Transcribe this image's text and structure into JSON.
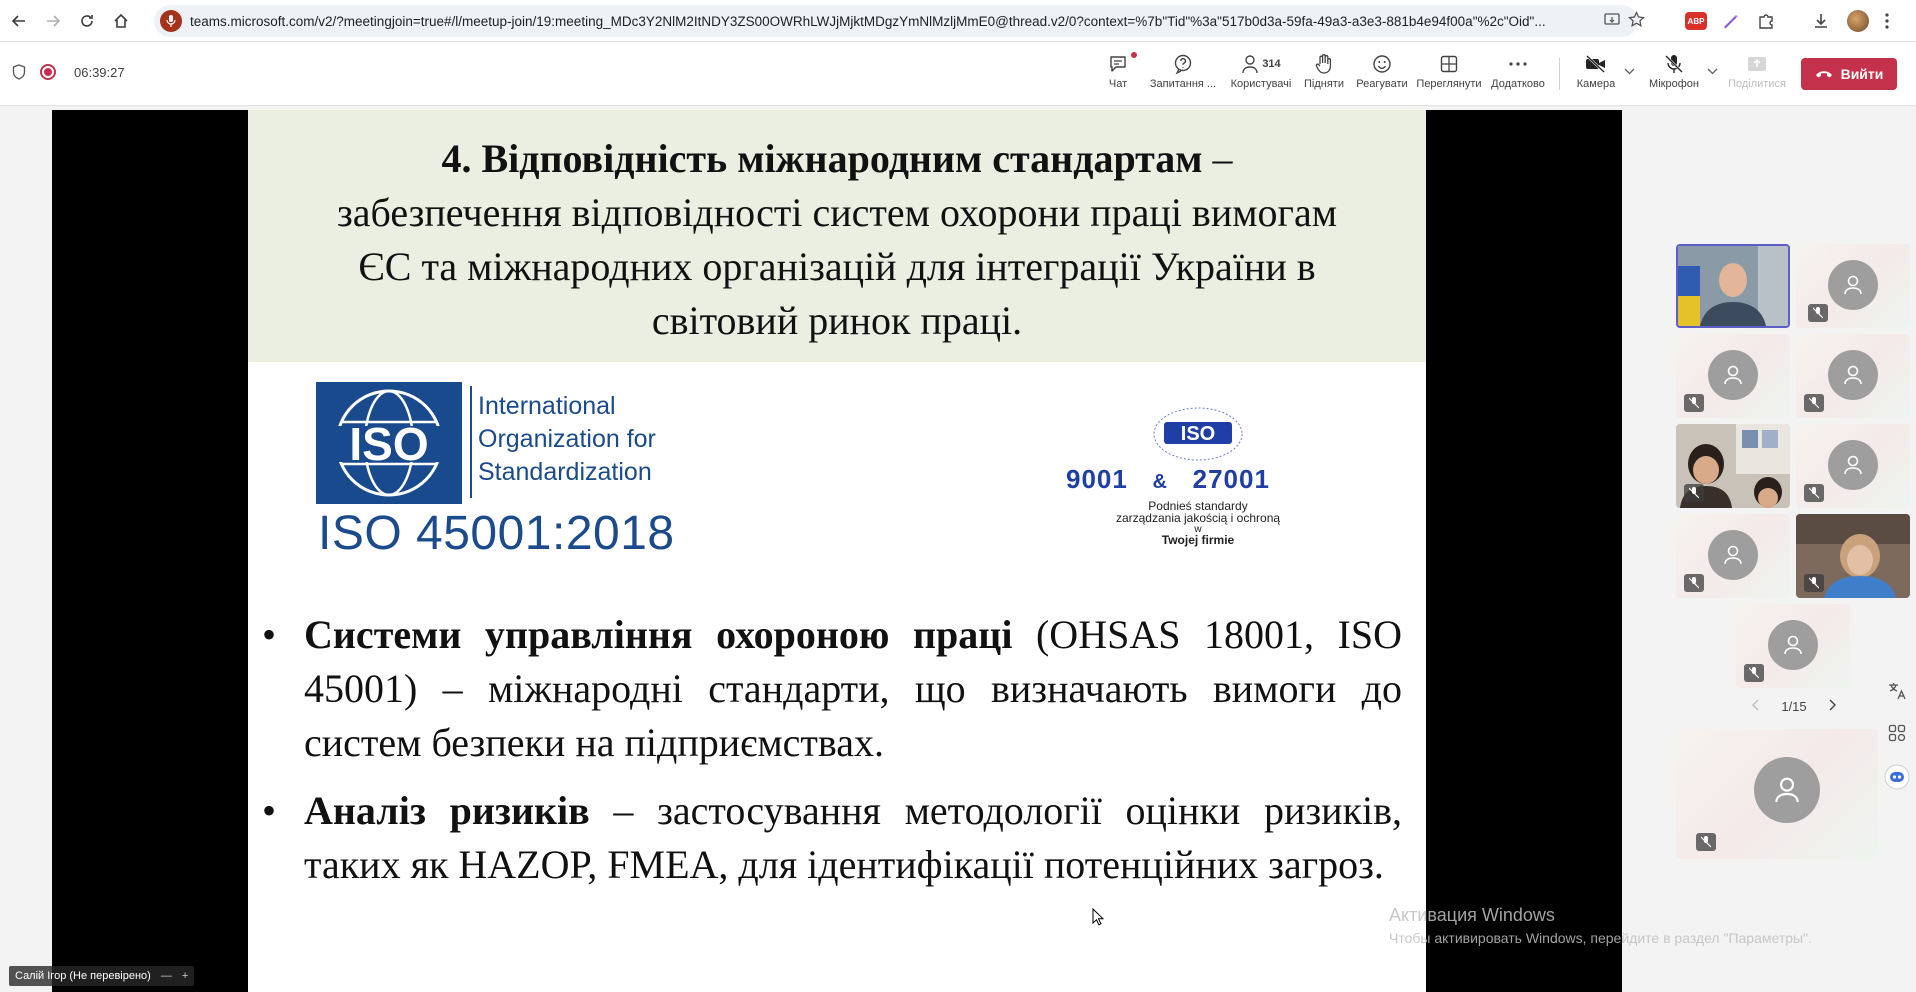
{
  "browser": {
    "url_host": "teams.microsoft.com",
    "url_rest": "/v2/?meetingjoin=true#/l/meetup-join/19:meeting_MDc3Y2NlM2ItNDY3ZS00OWRhLWJjMjktMDgzYmNlMzljMmE0@thread.v2/0?context=%7b\"Tid\"%3a\"517b0d3a-59fa-49a3-a3e3-881b4e94f00a\"%2c\"Oid\"...",
    "ext_abp": "ABP"
  },
  "meeting": {
    "timer": "06:39:27",
    "toolbar": {
      "chat": "Чат",
      "questions": "Запитання ...",
      "people": "Користувачі",
      "people_count": "314",
      "raise": "Підняти",
      "react": "Реагувати",
      "view": "Переглянути",
      "more": "Додатково",
      "camera": "Камера",
      "mic": "Мікрофон",
      "share": "Поділитися",
      "leave": "Вийти"
    }
  },
  "slide": {
    "title_bold": "4. Відповідність міжнародним стандартам",
    "title_dash": " –",
    "title_line2": "забезпечення відповідності систем охорони праці вимогам",
    "title_line3": "ЄС та міжнародних організацій для інтеграції України в",
    "title_line4": "світовий ринок праці.",
    "iso_logo_text": "ISO",
    "iso_org_line1": "International",
    "iso_org_line2": "Organization for",
    "iso_org_line3": "Standardization",
    "iso_standard": "ISO 45001:2018",
    "iso2_logo": "ISO",
    "iso2_num1": "9001",
    "iso2_amp": "&",
    "iso2_num2": "27001",
    "iso2_sub1": "Podnieś standardy",
    "iso2_sub2": "zarządzania jakością i ochroną",
    "iso2_sub3": "w",
    "iso2_sub4": "Twojej firmie",
    "bullets": [
      {
        "bold": "Системи управління охороною праці",
        "text": " (OHSAS 18001, ISO 45001) – міжнародні стандарти, що визначають вимоги до систем безпеки на підприємствах."
      },
      {
        "bold": "Аналіз ризиків",
        "text": " – застосування методології оцінки ризиків, таких як HAZOP, FMEA, для ідентифікації потенційних загроз."
      }
    ]
  },
  "presenter_name": "Салій Ігор (Не перевірено)",
  "watermark": {
    "title": "Активация Windows",
    "subtitle": "Чтобы активировать Windows, перейдите в раздел \"Параметры\"."
  },
  "gallery": {
    "page": "1/15"
  },
  "colors": {
    "leave": "#c4314b",
    "accent": "#5b5fc7",
    "iso_blue": "#1b4b8c",
    "slide_header_bg": "#ebefe2"
  }
}
